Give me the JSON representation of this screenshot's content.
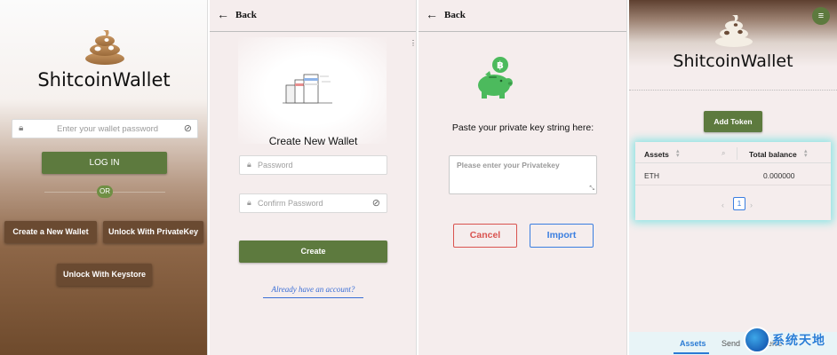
{
  "login_screen": {
    "brand": "ShitcoinWallet",
    "password_placeholder": "Enter your wallet password",
    "login_label": "LOG IN",
    "or_label": "OR",
    "create_wallet_label": "Create a New Wallet",
    "unlock_privatekey_label": "Unlock With PrivateKey",
    "unlock_keystore_label": "Unlock With Keystore"
  },
  "create_screen": {
    "back_label": "Back",
    "title": "Create New Wallet",
    "password_placeholder": "Password",
    "confirm_placeholder": "Confirm Password",
    "create_label": "Create",
    "have_account_link": "Already have an account?"
  },
  "import_screen": {
    "back_label": "Back",
    "instruction": "Paste your private key string here:",
    "privatekey_placeholder": "Please enter your Privatekey",
    "cancel_label": "Cancel",
    "import_label": "Import"
  },
  "assets_screen": {
    "brand": "ShitcoinWallet",
    "add_token_label": "Add Token",
    "columns": [
      "Assets",
      "Total balance"
    ],
    "rows": [
      {
        "asset": "ETH",
        "balance": "0.000000"
      }
    ],
    "page": "1",
    "tabs": [
      "Assets",
      "Send",
      "Receive"
    ],
    "watermark": "系统天地"
  },
  "colors": {
    "primary_green": "#5d7a3e",
    "brown_button": "#6a4a31",
    "cancel_red": "#d9534f",
    "import_blue": "#3a7ee0",
    "table_glow": "#8ee4e4"
  },
  "icons": [
    "lock-icon",
    "eye-slash-icon",
    "back-arrow-icon",
    "bitcoin-piggy-bank-icon",
    "menu-icon",
    "sort-icon",
    "search-icon",
    "chevron-left-icon",
    "chevron-right-icon",
    "poop-logo-icon"
  ]
}
